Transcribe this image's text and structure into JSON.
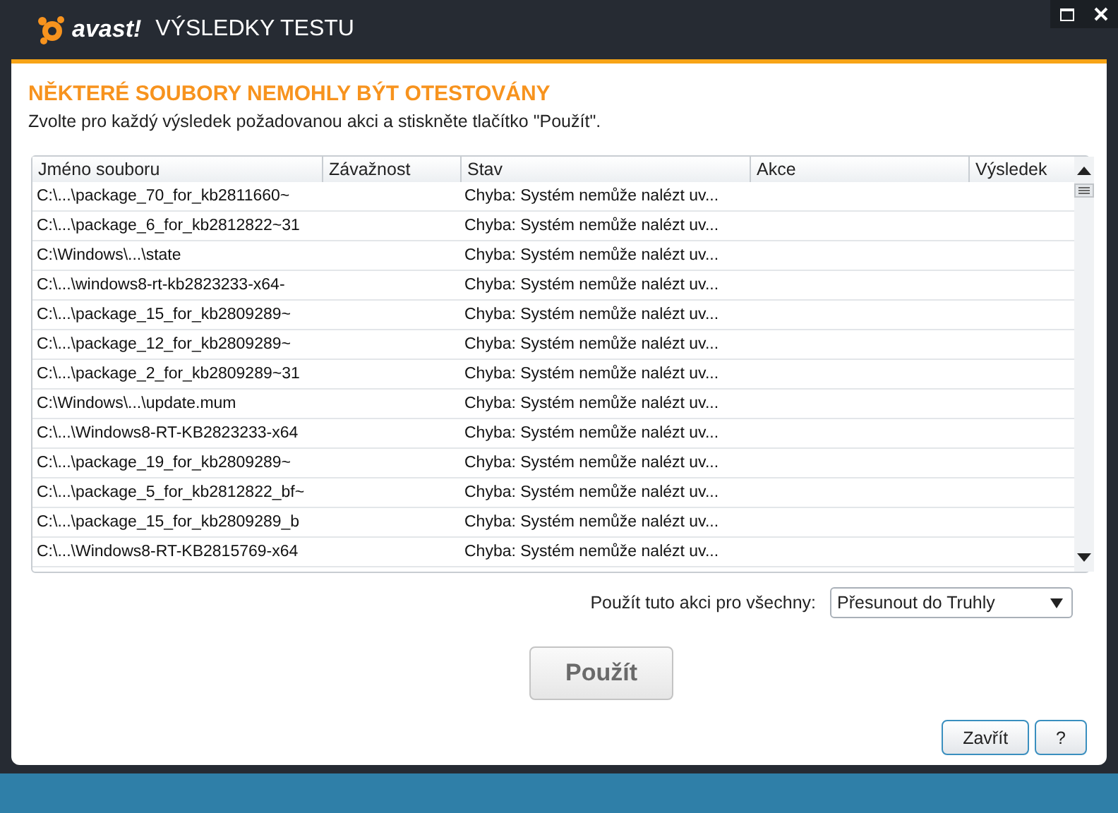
{
  "window": {
    "logo": "avast!",
    "title": "VÝSLEDKY TESTU"
  },
  "heading": "NĚKTERÉ SOUBORY NEMOHLY BÝT OTESTOVÁNY",
  "instruction": "Zvolte pro každý výsledek požadovanou akci a stiskněte tlačítko \"Použít\".",
  "table": {
    "columns": [
      "Jméno souboru",
      "Závažnost",
      "Stav",
      "Akce",
      "Výsledek"
    ],
    "rows": [
      [
        "C:\\...\\package_70_for_kb2811660~",
        "",
        "Chyba: Systém nemůže nalézt uv...",
        "",
        ""
      ],
      [
        "C:\\...\\package_6_for_kb2812822~31",
        "",
        "Chyba: Systém nemůže nalézt uv...",
        "",
        ""
      ],
      [
        "C:\\Windows\\...\\state",
        "",
        "Chyba: Systém nemůže nalézt uv...",
        "",
        ""
      ],
      [
        "C:\\...\\windows8-rt-kb2823233-x64-",
        "",
        "Chyba: Systém nemůže nalézt uv...",
        "",
        ""
      ],
      [
        "C:\\...\\package_15_for_kb2809289~",
        "",
        "Chyba: Systém nemůže nalézt uv...",
        "",
        ""
      ],
      [
        "C:\\...\\package_12_for_kb2809289~",
        "",
        "Chyba: Systém nemůže nalézt uv...",
        "",
        ""
      ],
      [
        "C:\\...\\package_2_for_kb2809289~31",
        "",
        "Chyba: Systém nemůže nalézt uv...",
        "",
        ""
      ],
      [
        "C:\\Windows\\...\\update.mum",
        "",
        "Chyba: Systém nemůže nalézt uv...",
        "",
        ""
      ],
      [
        "C:\\...\\Windows8-RT-KB2823233-x64",
        "",
        "Chyba: Systém nemůže nalézt uv...",
        "",
        ""
      ],
      [
        "C:\\...\\package_19_for_kb2809289~",
        "",
        "Chyba: Systém nemůže nalézt uv...",
        "",
        ""
      ],
      [
        "C:\\...\\package_5_for_kb2812822_bf~",
        "",
        "Chyba: Systém nemůže nalézt uv...",
        "",
        ""
      ],
      [
        "C:\\...\\package_15_for_kb2809289_b",
        "",
        "Chyba: Systém nemůže nalézt uv...",
        "",
        ""
      ],
      [
        "C:\\...\\Windows8-RT-KB2815769-x64",
        "",
        "Chyba: Systém nemůže nalézt uv...",
        "",
        ""
      ]
    ]
  },
  "apply_all": {
    "label": "Použít tuto akci pro všechny:",
    "value": "Přesunout do Truhly"
  },
  "buttons": [
    {
      "label": "Použít",
      "kind": "primary"
    },
    {
      "label": "Zavřít",
      "kind": "small"
    },
    {
      "label": "?",
      "kind": "small"
    }
  ]
}
